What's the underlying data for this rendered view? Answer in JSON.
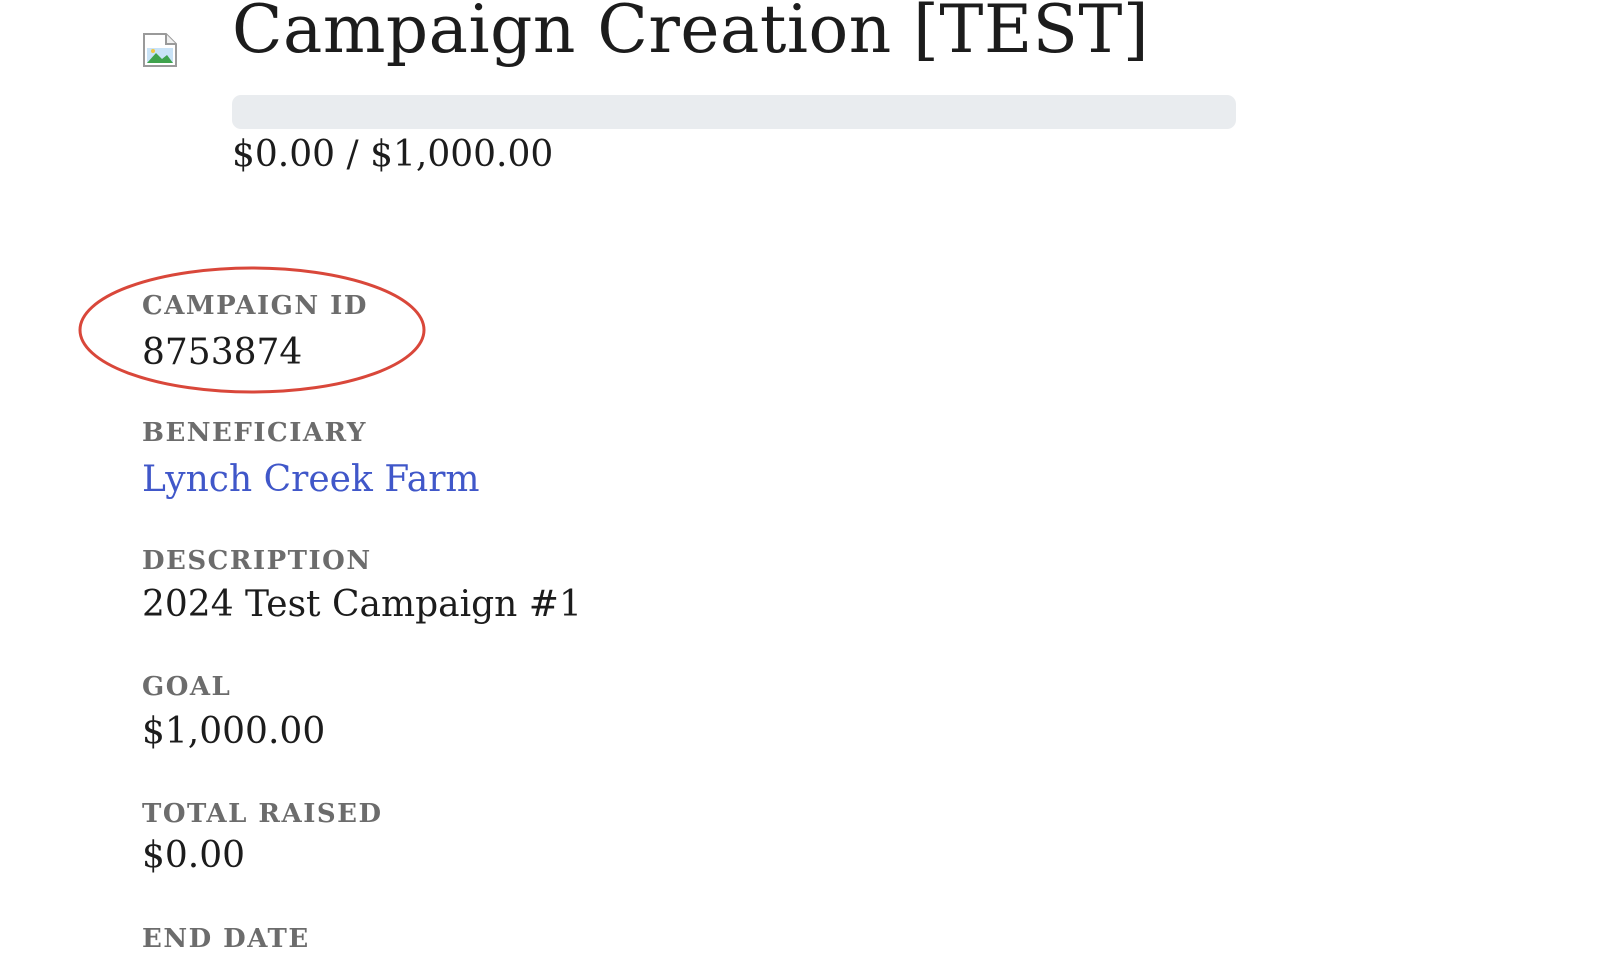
{
  "campaign": {
    "title": "Campaign Creation [TEST]",
    "progress_text": "$0.00 / $1,000.00",
    "progress_fraction": 0
  },
  "fields": {
    "campaign_id": {
      "label": "CAMPAIGN ID",
      "value": "8753874"
    },
    "beneficiary": {
      "label": "BENEFICIARY",
      "value": "Lynch Creek Farm"
    },
    "description": {
      "label": "DESCRIPTION",
      "value": "2024 Test Campaign #1"
    },
    "goal": {
      "label": "GOAL",
      "value": "$1,000.00"
    },
    "total_raised": {
      "label": "TOTAL RAISED",
      "value": "$0.00"
    },
    "end_date": {
      "label": "END DATE"
    }
  },
  "icons": {
    "campaign_image": "broken-image-icon"
  },
  "colors": {
    "link": "#4057c9",
    "label": "#6c6c6c",
    "progress_track": "#e9ecef",
    "annotation": "#d9473a"
  }
}
